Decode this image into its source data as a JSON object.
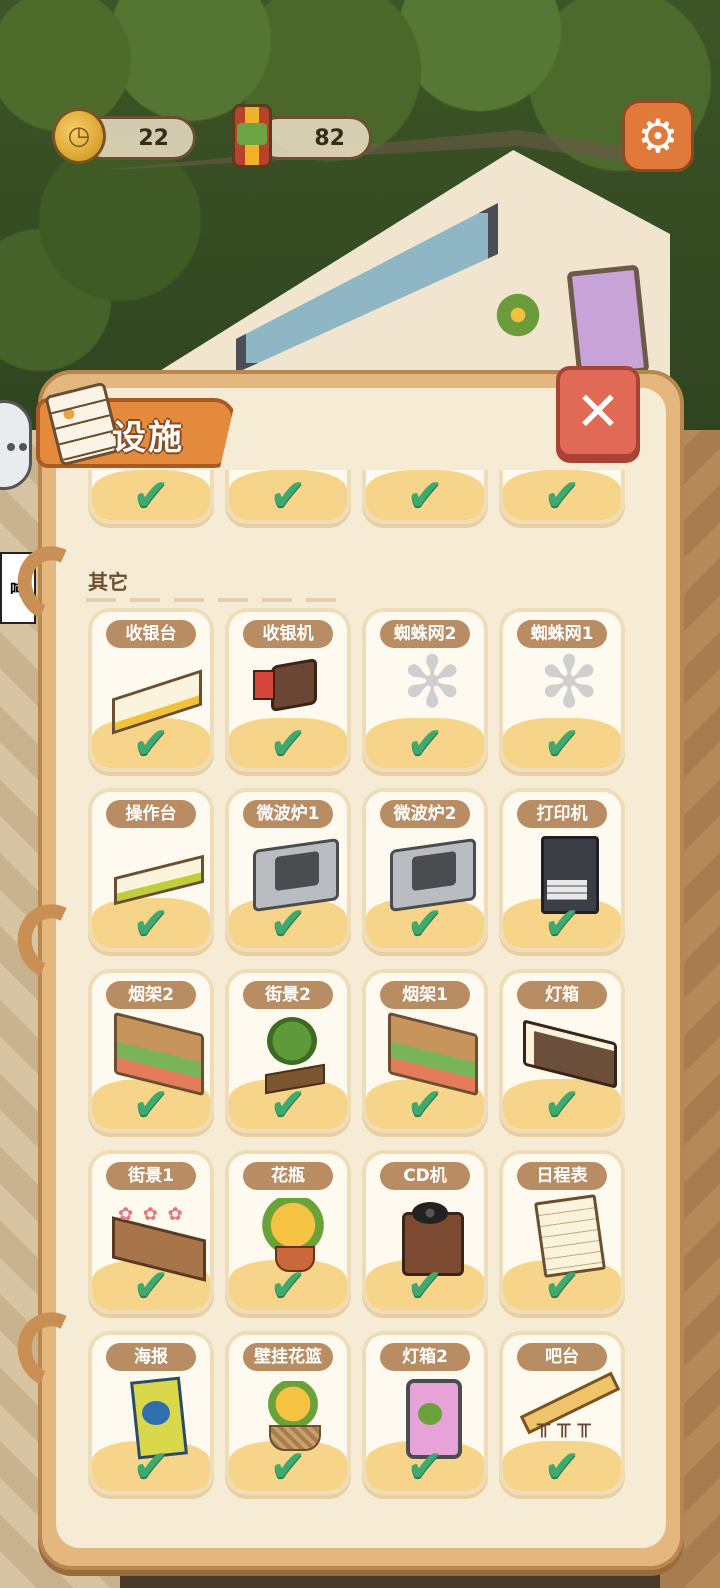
{
  "hud": {
    "coins": "22",
    "cans": "82",
    "coin_icon": "clock-coin-icon",
    "can_icon": "food-can-icon",
    "settings_icon": "gear-icon"
  },
  "side": {
    "tab_text": "吨"
  },
  "panel": {
    "title": "设施",
    "close_symbol": "✕",
    "check_symbol": "✔",
    "section_title": "其它"
  },
  "items": [
    {
      "label": "收银台",
      "art": "counter"
    },
    {
      "label": "收银机",
      "art": "register"
    },
    {
      "label": "蜘蛛网2",
      "art": "web"
    },
    {
      "label": "蜘蛛网1",
      "art": "web"
    },
    {
      "label": "操作台",
      "art": "bench"
    },
    {
      "label": "微波炉1",
      "art": "micro"
    },
    {
      "label": "微波炉2",
      "art": "micro"
    },
    {
      "label": "打印机",
      "art": "printer"
    },
    {
      "label": "烟架2",
      "art": "shelf"
    },
    {
      "label": "街景2",
      "art": "tree"
    },
    {
      "label": "烟架1",
      "art": "shelf"
    },
    {
      "label": "灯箱",
      "art": "lightbox"
    },
    {
      "label": "街景1",
      "art": "planter"
    },
    {
      "label": "花瓶",
      "art": "vase"
    },
    {
      "label": "CD机",
      "art": "cd"
    },
    {
      "label": "日程表",
      "art": "calendar"
    },
    {
      "label": "海报",
      "art": "poster"
    },
    {
      "label": "壁挂花篮",
      "art": "basket"
    },
    {
      "label": "灯箱2",
      "art": "lightbox2"
    },
    {
      "label": "吧台",
      "art": "bar"
    }
  ],
  "colors": {
    "panel_bg": "#f6ecd6",
    "panel_border": "#e3b77e",
    "header_orange": "#e48a3c",
    "close_red": "#e06a55",
    "check_green": "#3faa6f",
    "label_brown": "#b98d63"
  }
}
